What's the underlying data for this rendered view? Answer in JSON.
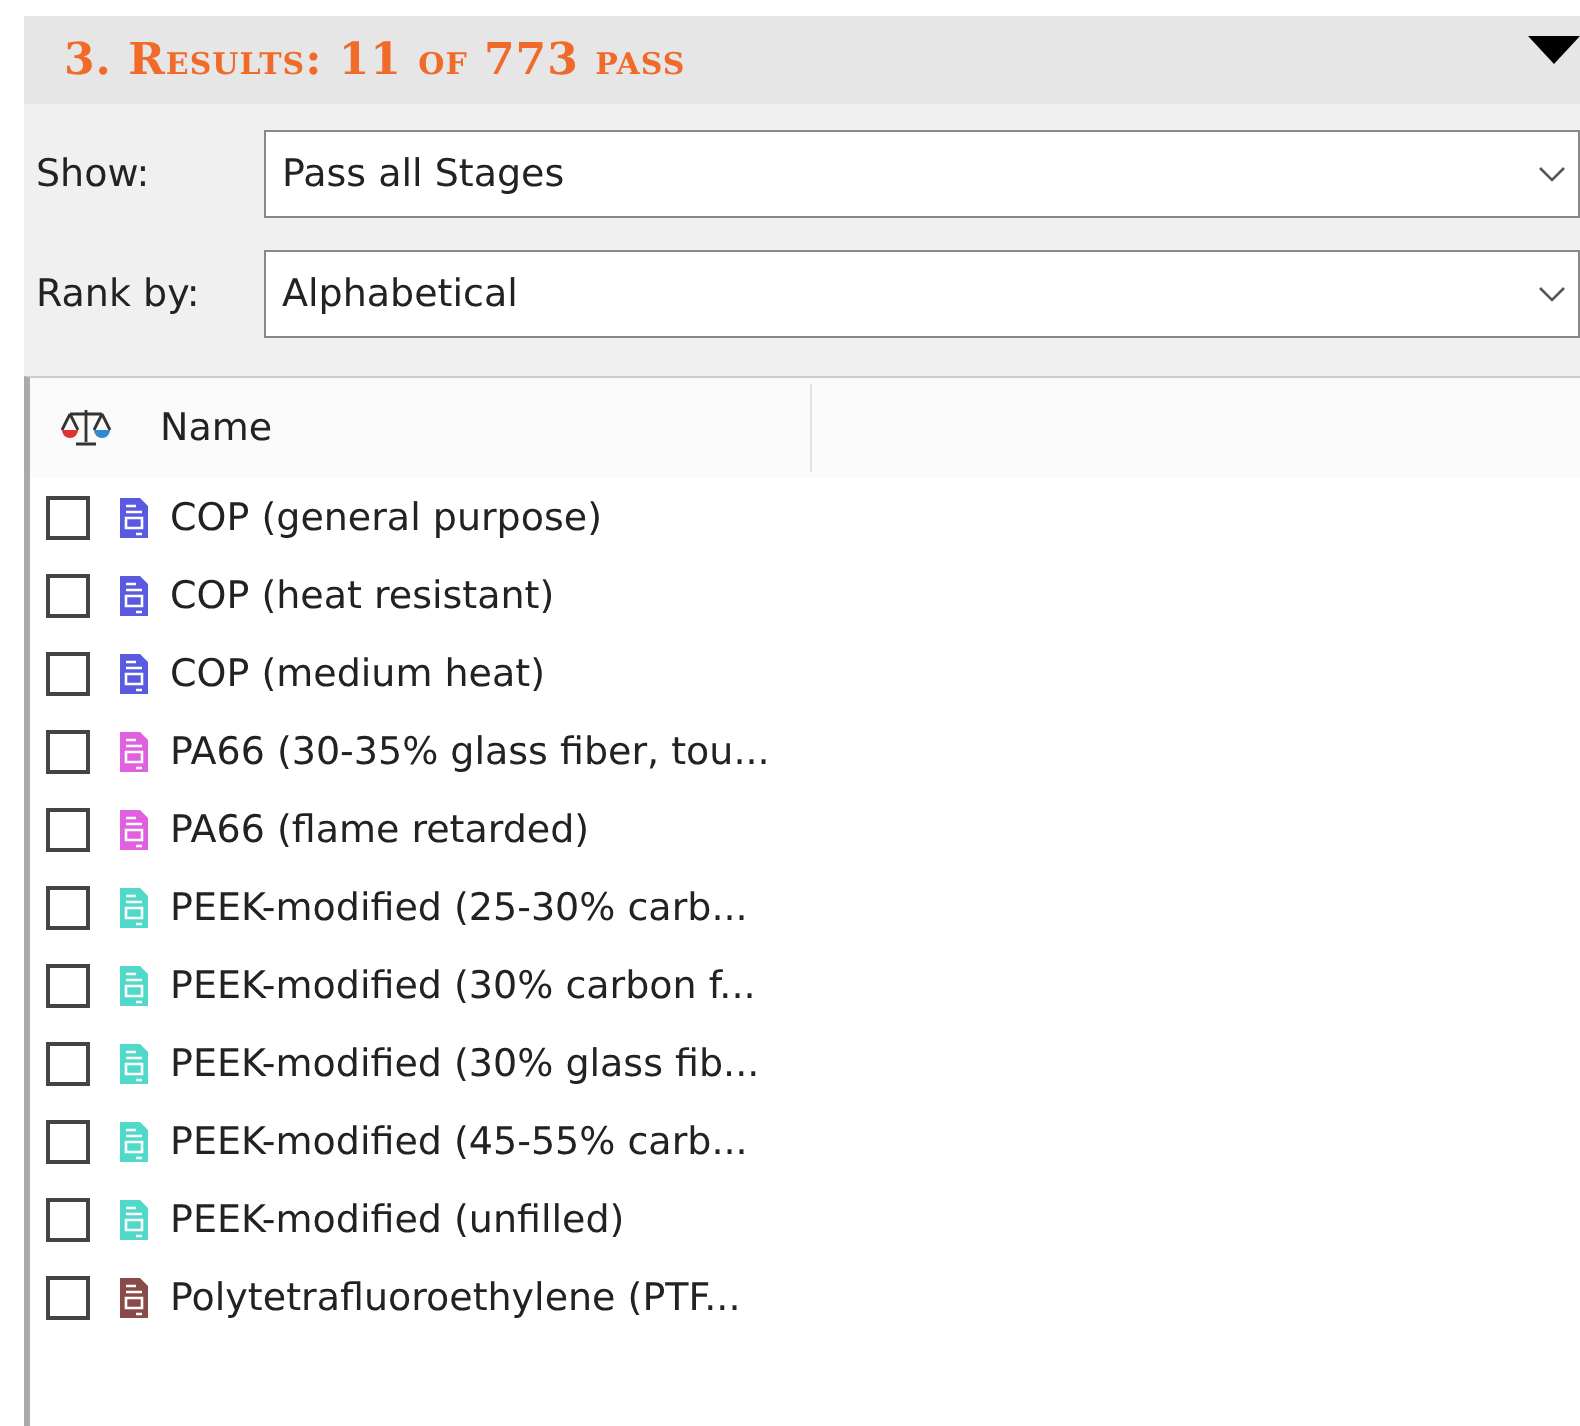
{
  "panel": {
    "title": "3. Results: 11 of 773 pass",
    "expanded": true
  },
  "filters": [
    {
      "label": "Show:",
      "value": "Pass all Stages"
    },
    {
      "label": "Rank by:",
      "value": "Alphabetical"
    }
  ],
  "table": {
    "columns": [
      "Name"
    ],
    "rows": [
      {
        "name": "COP (general purpose)",
        "checked": false,
        "color": "#5a5ae0"
      },
      {
        "name": "COP (heat resistant)",
        "checked": false,
        "color": "#5a5ae0"
      },
      {
        "name": "COP (medium heat)",
        "checked": false,
        "color": "#5a5ae0"
      },
      {
        "name": "PA66 (30-35% glass fiber, tou...",
        "checked": false,
        "color": "#e060e0"
      },
      {
        "name": "PA66 (flame retarded)",
        "checked": false,
        "color": "#e060e0"
      },
      {
        "name": "PEEK-modified (25-30% carb...",
        "checked": false,
        "color": "#50d8c8"
      },
      {
        "name": "PEEK-modified (30% carbon f...",
        "checked": false,
        "color": "#50d8c8"
      },
      {
        "name": "PEEK-modified (30% glass fib...",
        "checked": false,
        "color": "#50d8c8"
      },
      {
        "name": "PEEK-modified (45-55% carb...",
        "checked": false,
        "color": "#50d8c8"
      },
      {
        "name": "PEEK-modified (unfilled)",
        "checked": false,
        "color": "#50d8c8"
      },
      {
        "name": "Polytetrafluoroethylene (PTF...",
        "checked": false,
        "color": "#8a4a4a"
      }
    ]
  }
}
